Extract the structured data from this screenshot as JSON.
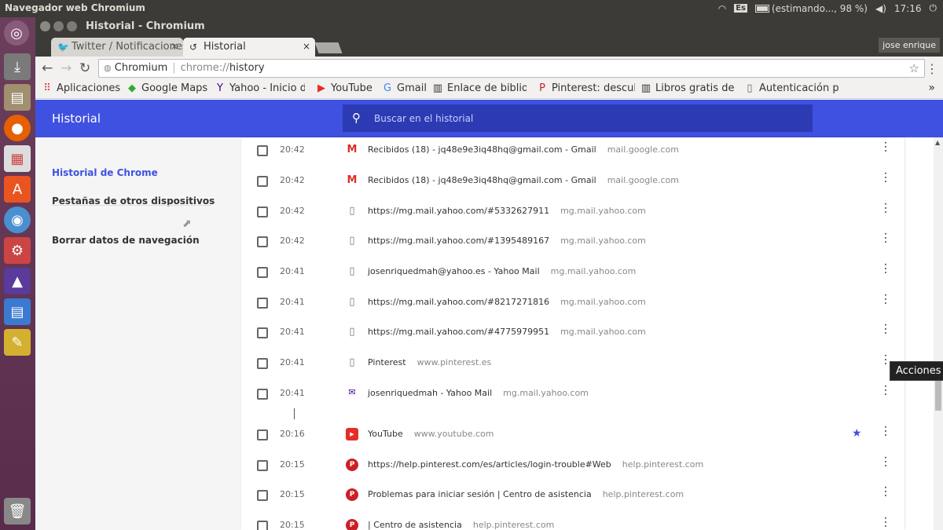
{
  "system": {
    "app_title": "Navegador web Chromium",
    "keyboard": "Es",
    "battery": "(estimando..., 98 %)",
    "clock": "17:16"
  },
  "window": {
    "title": "Historial - Chromium"
  },
  "tabs": [
    {
      "label": "Twitter / Notificaciones",
      "close": "×"
    },
    {
      "label": "Historial",
      "close": "×"
    }
  ],
  "user": "jose enrique",
  "omnibox": {
    "host": "Chromium",
    "scheme": "chrome://",
    "path": "history"
  },
  "bookmarks": [
    {
      "label": "Aplicaciones",
      "icon": "apps-grid-icon"
    },
    {
      "label": "Google Maps",
      "icon": "maps-icon"
    },
    {
      "label": "Yahoo - Inicio de",
      "icon": "yahoo-icon"
    },
    {
      "label": "YouTube",
      "icon": "youtube-icon"
    },
    {
      "label": "Gmail",
      "icon": "google-icon"
    },
    {
      "label": "Enlace de bibliot",
      "icon": "book-icon"
    },
    {
      "label": "Pinterest: descub",
      "icon": "pinterest-icon"
    },
    {
      "label": "Libros gratis de",
      "icon": "book-icon"
    },
    {
      "label": "Autenticación p",
      "icon": "page-icon"
    }
  ],
  "header": {
    "title": "Historial",
    "search_placeholder": "Buscar en el historial"
  },
  "sidebar": {
    "items": [
      {
        "label": "Historial de Chrome",
        "color": "#3f51e0"
      },
      {
        "label": "Pestañas de otros dispositivos",
        "color": "#333333"
      },
      {
        "label": "Borrar datos de navegación",
        "color": "#333333"
      }
    ]
  },
  "history": [
    {
      "time": "20:42",
      "title": "Recibidos (18) - jq48e9e3iq48hq@gmail.com - Gmail",
      "domain": "mail.google.com",
      "icon": "gmail",
      "starred": false
    },
    {
      "time": "20:42",
      "title": "Recibidos (18) - jq48e9e3iq48hq@gmail.com - Gmail",
      "domain": "mail.google.com",
      "icon": "gmail",
      "starred": false
    },
    {
      "time": "20:42",
      "title": "https://mg.mail.yahoo.com/#5332627911",
      "domain": "mg.mail.yahoo.com",
      "icon": "page",
      "starred": false
    },
    {
      "time": "20:42",
      "title": "https://mg.mail.yahoo.com/#1395489167",
      "domain": "mg.mail.yahoo.com",
      "icon": "page",
      "starred": false
    },
    {
      "time": "20:41",
      "title": "josenriquedmah@yahoo.es - Yahoo Mail",
      "domain": "mg.mail.yahoo.com",
      "icon": "page",
      "starred": false
    },
    {
      "time": "20:41",
      "title": "https://mg.mail.yahoo.com/#8217271816",
      "domain": "mg.mail.yahoo.com",
      "icon": "page",
      "starred": false
    },
    {
      "time": "20:41",
      "title": "https://mg.mail.yahoo.com/#4775979951",
      "domain": "mg.mail.yahoo.com",
      "icon": "page",
      "starred": false
    },
    {
      "time": "20:41",
      "title": "Pinterest",
      "domain": "www.pinterest.es",
      "icon": "page",
      "starred": false
    },
    {
      "time": "20:41",
      "title": "josenriquedmah - Yahoo Mail",
      "domain": "mg.mail.yahoo.com",
      "icon": "yahoo-mail",
      "starred": false
    },
    {
      "time": "20:16",
      "title": "YouTube",
      "domain": "www.youtube.com",
      "icon": "youtube",
      "starred": true
    },
    {
      "time": "20:15",
      "title": "https://help.pinterest.com/es/articles/login-trouble#Web",
      "domain": "help.pinterest.com",
      "icon": "pinterest",
      "starred": false
    },
    {
      "time": "20:15",
      "title": "Problemas para iniciar sesión | Centro de asistencia",
      "domain": "help.pinterest.com",
      "icon": "pinterest",
      "starred": false
    },
    {
      "time": "20:15",
      "title": "| Centro de asistencia",
      "domain": "help.pinterest.com",
      "icon": "pinterest",
      "starred": false
    }
  ],
  "tooltip": "Acciones",
  "colors": {
    "header": "#3f51e0",
    "search": "#2c3bb3",
    "star": "#3f51e0",
    "launcher": "#5a2c4c"
  }
}
